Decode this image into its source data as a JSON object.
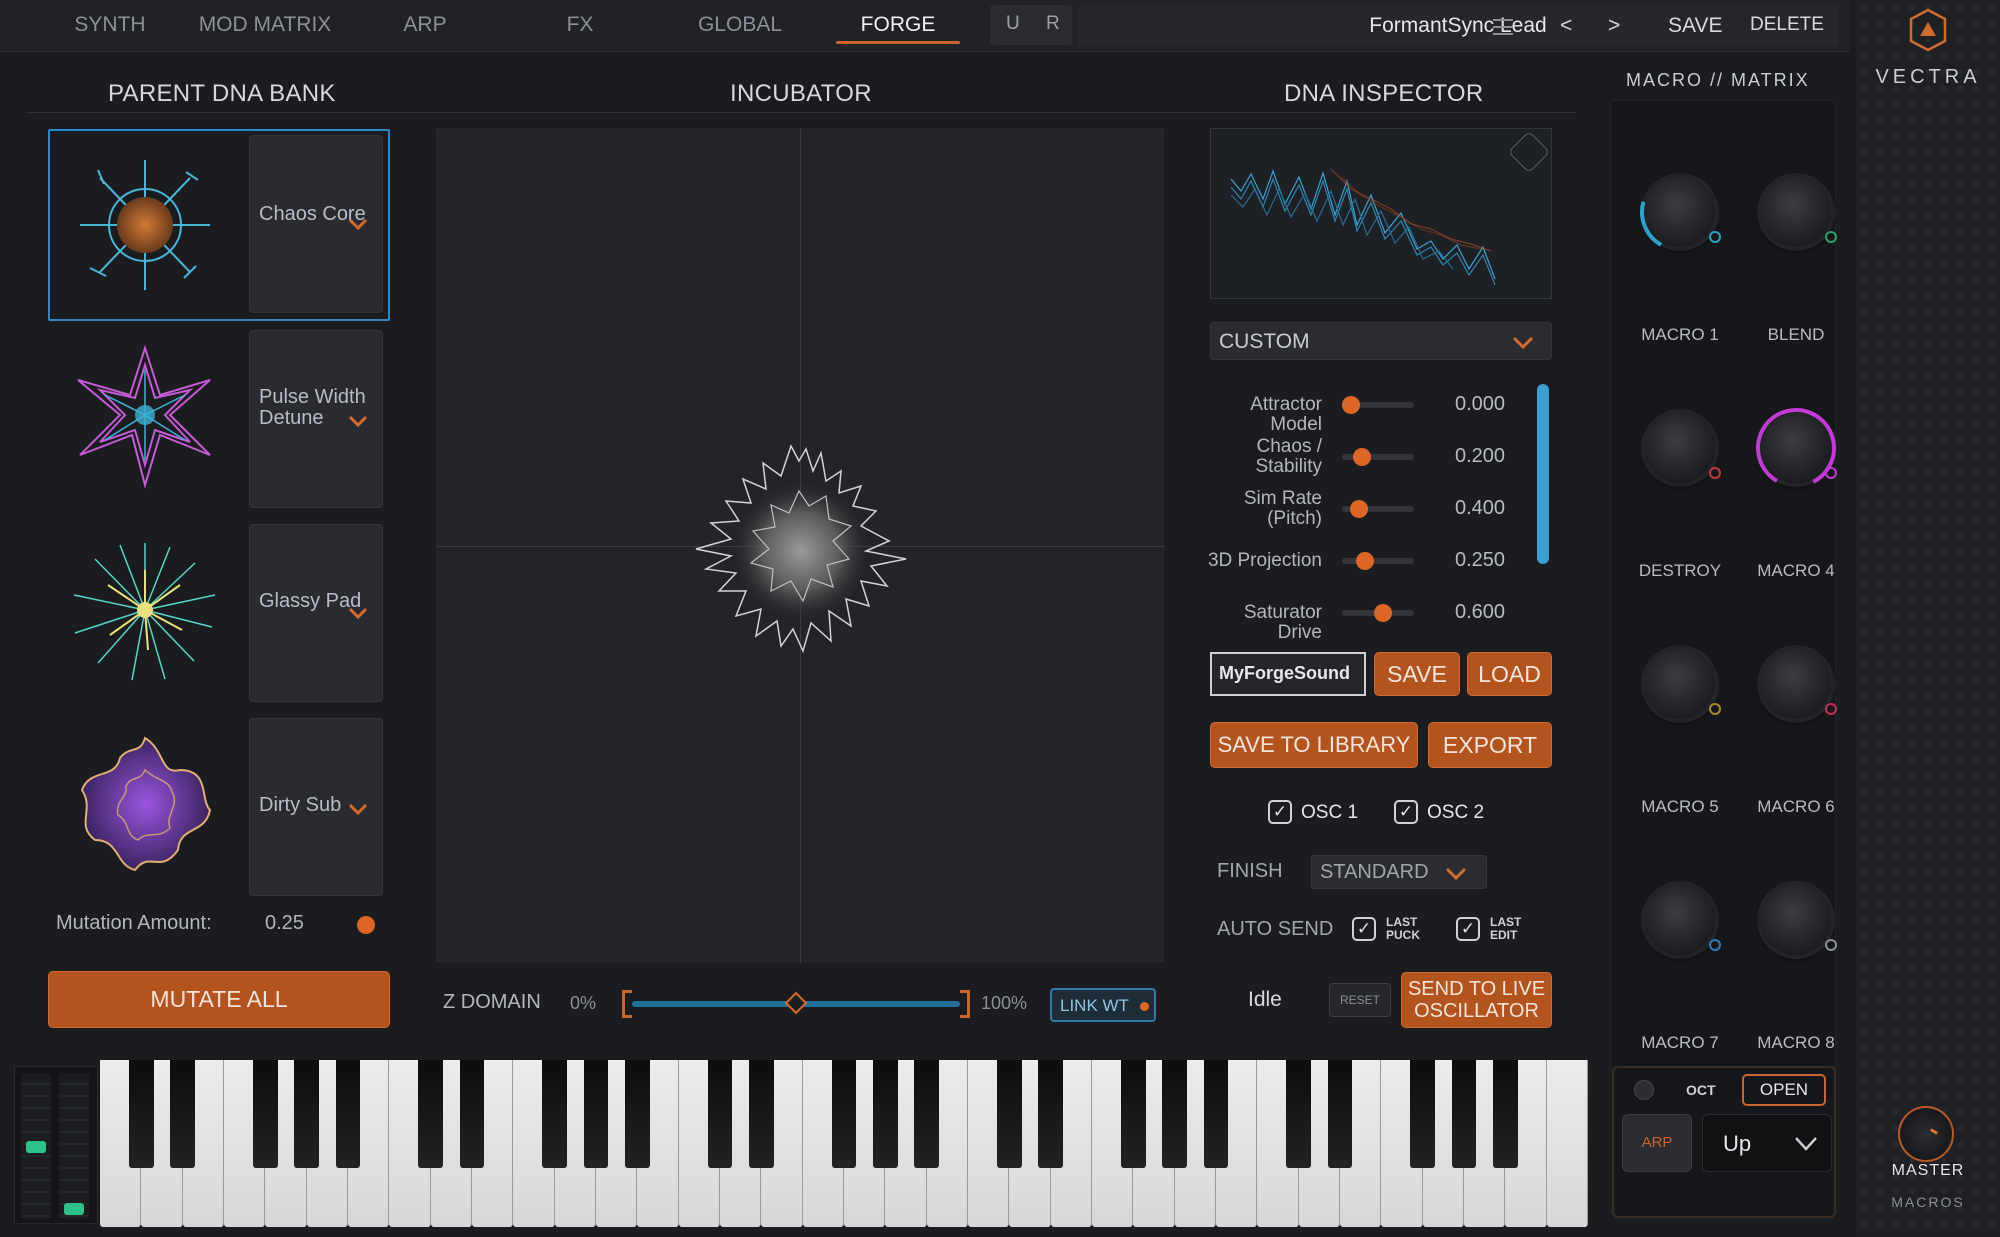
{
  "tabs": [
    {
      "label": "SYNTH",
      "active": false
    },
    {
      "label": "MOD MATRIX",
      "active": false
    },
    {
      "label": "ARP",
      "active": false
    },
    {
      "label": "FX",
      "active": false
    },
    {
      "label": "GLOBAL",
      "active": false
    },
    {
      "label": "FORGE",
      "active": true
    }
  ],
  "undo_redo": {
    "undo": "U",
    "redo": "R"
  },
  "preset": {
    "name": "FormantSync Lead",
    "menu_icon": "hamburger-icon",
    "prev": "<",
    "next": ">",
    "save": "SAVE",
    "delete": "DELETE"
  },
  "brand": {
    "name": "VECTRA",
    "master_label": "MASTER",
    "macros_label": "MACROS"
  },
  "sections": {
    "parent_bank": "PARENT DNA BANK",
    "incubator": "INCUBATOR",
    "inspector": "DNA INSPECTOR",
    "macro_matrix": "MACRO // MATRIX"
  },
  "dna_bank": {
    "cells": [
      {
        "name": "Chaos Core",
        "selected": true
      },
      {
        "name": "Pulse Width Detune",
        "selected": false
      },
      {
        "name": "Glassy Pad",
        "selected": false
      },
      {
        "name": "Dirty Sub",
        "selected": false
      }
    ],
    "mutation_label": "Mutation Amount:",
    "mutation_value": "0.25",
    "mutate_all": "MUTATE ALL"
  },
  "z_domain": {
    "label": "Z DOMAIN",
    "min": "0%",
    "max": "100%",
    "position": 0.5,
    "link": "LINK WT"
  },
  "inspector": {
    "mode": "CUSTOM",
    "params": [
      {
        "label": "Attractor Model",
        "value": "0.000",
        "level": 0.0
      },
      {
        "label": "Chaos / Stability",
        "value": "0.200",
        "level": 0.2
      },
      {
        "label": "Sim Rate (Pitch)",
        "value": "0.400",
        "level": 0.15
      },
      {
        "label": "3D Projection",
        "value": "0.250",
        "level": 0.25
      },
      {
        "label": "Saturator Drive",
        "value": "0.600",
        "level": 0.6
      }
    ],
    "name_field": "MyForgeSound",
    "save": "SAVE",
    "load": "LOAD",
    "save_library": "SAVE TO LIBRARY",
    "export": "EXPORT",
    "osc1": "OSC 1",
    "osc2": "OSC 2",
    "finish_label": "FINISH",
    "finish_value": "STANDARD",
    "auto_send_label": "AUTO SEND",
    "last_puck": "LAST PUCK",
    "last_edit": "LAST EDIT",
    "status": "Idle",
    "reset": "RESET",
    "send_live": "SEND TO LIVE OSCILLATOR"
  },
  "macros": [
    {
      "label": "MACRO 1",
      "color": "#2aa3c8",
      "level": 0.25
    },
    {
      "label": "BLEND",
      "color": "#2aa067",
      "level": 0
    },
    {
      "label": "DESTROY",
      "color": "#c33a3a",
      "level": 0
    },
    {
      "label": "MACRO 4",
      "color": "#c43ad8",
      "level": 1.0
    },
    {
      "label": "MACRO 5",
      "color": "#a98b22",
      "level": 0
    },
    {
      "label": "MACRO 6",
      "color": "#c2305a",
      "level": 0
    },
    {
      "label": "MACRO 7",
      "color": "#2e7bbd",
      "level": 0
    },
    {
      "label": "MACRO 8",
      "color": "#8c8f96",
      "level": 0
    }
  ],
  "arp_panel": {
    "oct": "OCT",
    "open": "OPEN",
    "arp": "ARP",
    "mode": "Up"
  },
  "colors": {
    "accent": "#c8642c",
    "selection": "#2d87c9",
    "scroll": "#3a9ed0"
  }
}
